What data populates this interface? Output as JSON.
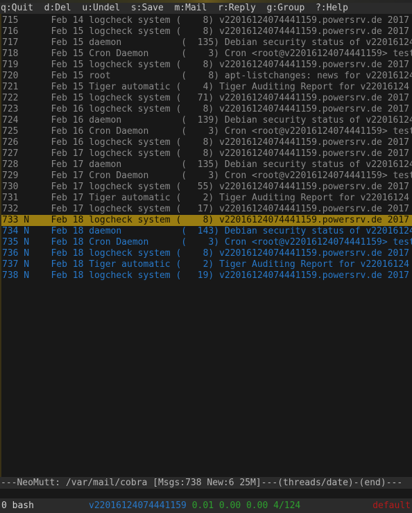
{
  "window": {
    "app": "NeoMutt",
    "shell": "bash"
  },
  "helpbar": {
    "text": "q:Quit  d:Del  u:Undel  s:Save  m:Mail  r:Reply  g:Group  ?:Help",
    "items": [
      {
        "key": "q",
        "label": "Quit"
      },
      {
        "key": "d",
        "label": "Del"
      },
      {
        "key": "u",
        "label": "Undel"
      },
      {
        "key": "s",
        "label": "Save"
      },
      {
        "key": "m",
        "label": "Mail"
      },
      {
        "key": "r",
        "label": "Reply"
      },
      {
        "key": "g",
        "label": "Group"
      },
      {
        "key": "?",
        "label": "Help"
      }
    ]
  },
  "index": {
    "rows": [
      {
        "line": "715      Feb 14 logcheck system (    8) v22016124074441159.powersrv.de 2017",
        "state": "read"
      },
      {
        "line": "716      Feb 15 logcheck system (    8) v22016124074441159.powersrv.de 2017",
        "state": "read"
      },
      {
        "line": "717      Feb 15 daemon           (  135) Debian security status of v22016124",
        "state": "read"
      },
      {
        "line": "718      Feb 15 Cron Daemon      (    3) Cron <root@v22016124074441159> test",
        "state": "read"
      },
      {
        "line": "719      Feb 15 logcheck system (    8) v22016124074441159.powersrv.de 2017",
        "state": "read"
      },
      {
        "line": "720      Feb 15 root             (    8) apt-listchanges: news for v22016124",
        "state": "read"
      },
      {
        "line": "721      Feb 15 Tiger automatic (    4) Tiger Auditing Report for v22016124",
        "state": "read"
      },
      {
        "line": "722      Feb 15 logcheck system (   71) v22016124074441159.powersrv.de 2017",
        "state": "read"
      },
      {
        "line": "723      Feb 16 logcheck system (    8) v22016124074441159.powersrv.de 2017",
        "state": "read"
      },
      {
        "line": "724      Feb 16 daemon           (  139) Debian security status of v22016124",
        "state": "read"
      },
      {
        "line": "725      Feb 16 Cron Daemon      (    3) Cron <root@v22016124074441159> test",
        "state": "read"
      },
      {
        "line": "726      Feb 16 logcheck system (    8) v22016124074441159.powersrv.de 2017",
        "state": "read"
      },
      {
        "line": "727      Feb 17 logcheck system (    8) v22016124074441159.powersrv.de 2017",
        "state": "read"
      },
      {
        "line": "728      Feb 17 daemon           (  135) Debian security status of v22016124",
        "state": "read"
      },
      {
        "line": "729      Feb 17 Cron Daemon      (    3) Cron <root@v22016124074441159> test",
        "state": "read"
      },
      {
        "line": "730      Feb 17 logcheck system (   55) v22016124074441159.powersrv.de 2017",
        "state": "read"
      },
      {
        "line": "731      Feb 17 Tiger automatic (    2) Tiger Auditing Report for v22016124",
        "state": "read"
      },
      {
        "line": "732      Feb 17 logcheck system (   17) v22016124074441159.powersrv.de 2017",
        "state": "read"
      },
      {
        "line": "733 N    Feb 18 logcheck system (    8) v22016124074441159.powersrv.de 2017",
        "state": "selected"
      },
      {
        "line": "734 N    Feb 18 daemon           (  143) Debian security status of v22016124",
        "state": "new"
      },
      {
        "line": "735 N    Feb 18 Cron Daemon      (    3) Cron <root@v22016124074441159> test",
        "state": "new"
      },
      {
        "line": "736 N    Feb 18 logcheck system (    8) v22016124074441159.powersrv.de 2017",
        "state": "new"
      },
      {
        "line": "737 N    Feb 18 Tiger automatic (    2) Tiger Auditing Report for v22016124",
        "state": "new"
      },
      {
        "line": "738 N    Feb 18 logcheck system (   19) v22016124074441159.powersrv.de 2017",
        "state": "new"
      }
    ],
    "selected_index": 18,
    "messages": [
      {
        "num": "715",
        "flag": "",
        "date": "Feb 14",
        "author": "logcheck system",
        "size": "8",
        "subject": "v22016124074441159.powersrv.de 2017"
      },
      {
        "num": "716",
        "flag": "",
        "date": "Feb 15",
        "author": "logcheck system",
        "size": "8",
        "subject": "v22016124074441159.powersrv.de 2017"
      },
      {
        "num": "717",
        "flag": "",
        "date": "Feb 15",
        "author": "daemon",
        "size": "135",
        "subject": "Debian security status of v22016124"
      },
      {
        "num": "718",
        "flag": "",
        "date": "Feb 15",
        "author": "Cron Daemon",
        "size": "3",
        "subject": "Cron <root@v22016124074441159> test"
      },
      {
        "num": "719",
        "flag": "",
        "date": "Feb 15",
        "author": "logcheck system",
        "size": "8",
        "subject": "v22016124074441159.powersrv.de 2017"
      },
      {
        "num": "720",
        "flag": "",
        "date": "Feb 15",
        "author": "root",
        "size": "8",
        "subject": "apt-listchanges: news for v22016124"
      },
      {
        "num": "721",
        "flag": "",
        "date": "Feb 15",
        "author": "Tiger automatic",
        "size": "4",
        "subject": "Tiger Auditing Report for v22016124"
      },
      {
        "num": "722",
        "flag": "",
        "date": "Feb 15",
        "author": "logcheck system",
        "size": "71",
        "subject": "v22016124074441159.powersrv.de 2017"
      },
      {
        "num": "723",
        "flag": "",
        "date": "Feb 16",
        "author": "logcheck system",
        "size": "8",
        "subject": "v22016124074441159.powersrv.de 2017"
      },
      {
        "num": "724",
        "flag": "",
        "date": "Feb 16",
        "author": "daemon",
        "size": "139",
        "subject": "Debian security status of v22016124"
      },
      {
        "num": "725",
        "flag": "",
        "date": "Feb 16",
        "author": "Cron Daemon",
        "size": "3",
        "subject": "Cron <root@v22016124074441159> test"
      },
      {
        "num": "726",
        "flag": "",
        "date": "Feb 16",
        "author": "logcheck system",
        "size": "8",
        "subject": "v22016124074441159.powersrv.de 2017"
      },
      {
        "num": "727",
        "flag": "",
        "date": "Feb 17",
        "author": "logcheck system",
        "size": "8",
        "subject": "v22016124074441159.powersrv.de 2017"
      },
      {
        "num": "728",
        "flag": "",
        "date": "Feb 17",
        "author": "daemon",
        "size": "135",
        "subject": "Debian security status of v22016124"
      },
      {
        "num": "729",
        "flag": "",
        "date": "Feb 17",
        "author": "Cron Daemon",
        "size": "3",
        "subject": "Cron <root@v22016124074441159> test"
      },
      {
        "num": "730",
        "flag": "",
        "date": "Feb 17",
        "author": "logcheck system",
        "size": "55",
        "subject": "v22016124074441159.powersrv.de 2017"
      },
      {
        "num": "731",
        "flag": "",
        "date": "Feb 17",
        "author": "Tiger automatic",
        "size": "2",
        "subject": "Tiger Auditing Report for v22016124"
      },
      {
        "num": "732",
        "flag": "",
        "date": "Feb 17",
        "author": "logcheck system",
        "size": "17",
        "subject": "v22016124074441159.powersrv.de 2017"
      },
      {
        "num": "733",
        "flag": "N",
        "date": "Feb 18",
        "author": "logcheck system",
        "size": "8",
        "subject": "v22016124074441159.powersrv.de 2017"
      },
      {
        "num": "734",
        "flag": "N",
        "date": "Feb 18",
        "author": "daemon",
        "size": "143",
        "subject": "Debian security status of v22016124"
      },
      {
        "num": "735",
        "flag": "N",
        "date": "Feb 18",
        "author": "Cron Daemon",
        "size": "3",
        "subject": "Cron <root@v22016124074441159> test"
      },
      {
        "num": "736",
        "flag": "N",
        "date": "Feb 18",
        "author": "logcheck system",
        "size": "8",
        "subject": "v22016124074441159.powersrv.de 2017"
      },
      {
        "num": "737",
        "flag": "N",
        "date": "Feb 18",
        "author": "Tiger automatic",
        "size": "2",
        "subject": "Tiger Auditing Report for v22016124"
      },
      {
        "num": "738",
        "flag": "N",
        "date": "Feb 18",
        "author": "logcheck system",
        "size": "19",
        "subject": "v22016124074441159.powersrv.de 2017"
      }
    ]
  },
  "statusline": {
    "text": "---NeoMutt: /var/mail/cobra [Msgs:738 New:6 25M]---(threads/date)-(end)---",
    "mailbox": "/var/mail/cobra",
    "msgs": "738",
    "new": "6",
    "size": "25M",
    "sort": "threads/date",
    "position": "end"
  },
  "tmux": {
    "window": "0 bash",
    "host": "v22016124074441159",
    "load": "0.01 0.00 0.00 4/124",
    "session": "default"
  },
  "colors": {
    "background": "#181818",
    "bar_background": "#2b2b2b",
    "read_text": "#8a8a8a",
    "new_text": "#2878c8",
    "selected_bg": "#9a7d12",
    "selected_fg": "#111007",
    "load_green": "#2ea02e",
    "session_red": "#b51a1a"
  }
}
